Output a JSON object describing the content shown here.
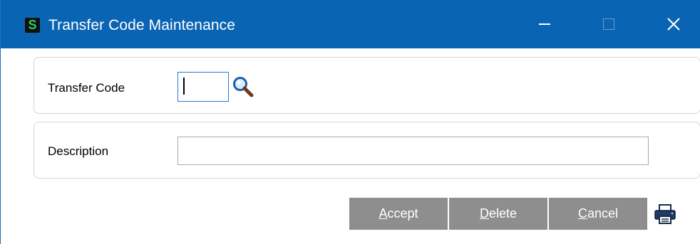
{
  "window": {
    "title": "Transfer Code Maintenance",
    "app_icon_letter": "S",
    "titlebar_color": "#0a64b4"
  },
  "form": {
    "transfer_code_label": "Transfer Code",
    "transfer_code_value": "",
    "description_label": "Description",
    "description_value": ""
  },
  "buttons": {
    "accept": {
      "mnemonic": "A",
      "rest": "ccept"
    },
    "delete": {
      "mnemonic": "D",
      "rest": "elete"
    },
    "cancel": {
      "mnemonic": "C",
      "rest": "ancel"
    }
  },
  "icons": {
    "lookup": "magnifier-icon",
    "print": "printer-icon",
    "minimize": "minimize-icon",
    "maximize": "maximize-icon",
    "close": "close-icon"
  }
}
